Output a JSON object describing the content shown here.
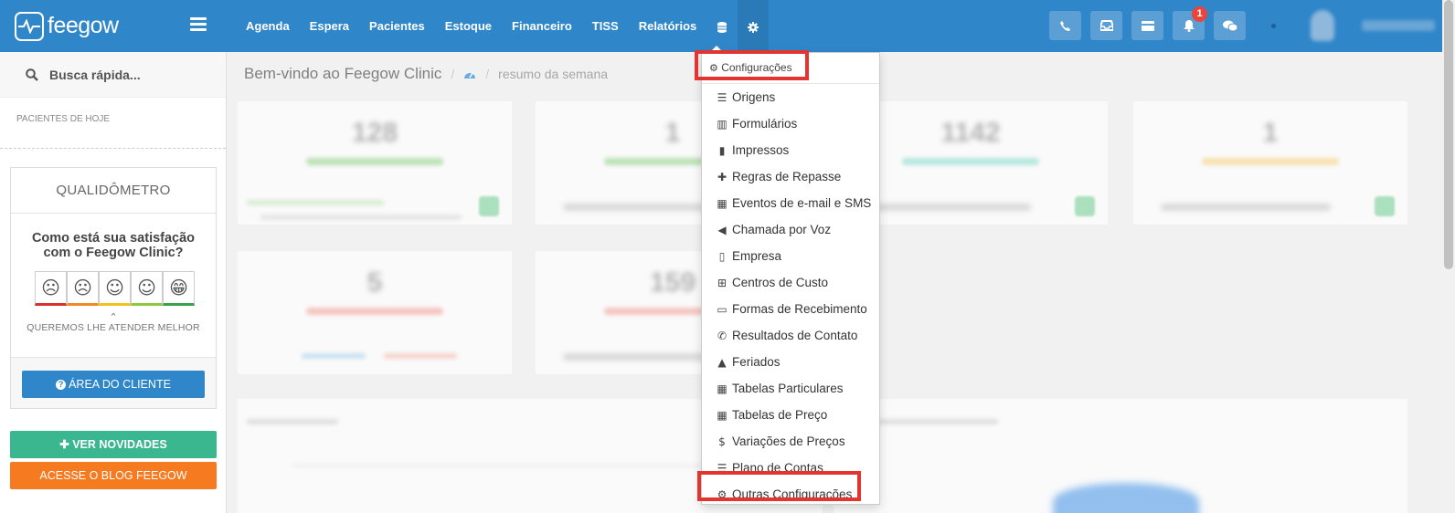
{
  "brand": {
    "name": "feegow"
  },
  "nav": {
    "items": [
      "Agenda",
      "Espera",
      "Pacientes",
      "Estoque",
      "Financeiro",
      "TISS",
      "Relatórios"
    ],
    "database_icon": "database-icon",
    "settings_icon": "gear-icon"
  },
  "topbar": {
    "notification_count": "1",
    "buttons": [
      "phone-icon",
      "inbox-icon",
      "card-icon",
      "bell-icon",
      "chat-icon"
    ]
  },
  "sidebar": {
    "search_placeholder": "Busca rápida...",
    "pacientes_hoje": "PACIENTES DE HOJE",
    "qualidometro_title": "QUALIDÔMETRO",
    "question": "Como está sua satisfação com o Feegow Clinic?",
    "faces": [
      "☹",
      "☹",
      "☺",
      "☺",
      "😁"
    ],
    "face_colors": [
      "#d9302b",
      "#f08a24",
      "#f2c418",
      "#8dc63f",
      "#3aa14d"
    ],
    "subtitle": "QUEREMOS LHE ATENDER MELHOR",
    "area_cliente": "ÁREA DO CLIENTE",
    "ver_novidades": "VER NOVIDADES",
    "blog": "ACESSE O BLOG FEEGOW"
  },
  "main": {
    "title": "Bem-vindo ao Feegow Clinic",
    "breadcrumb_sub": "resumo da semana"
  },
  "dropdown": {
    "header": "Configurações",
    "items": [
      {
        "icon": "☰",
        "label": "Origens"
      },
      {
        "icon": "▥",
        "label": "Formulários"
      },
      {
        "icon": "▮",
        "label": "Impressos"
      },
      {
        "icon": "✚",
        "label": "Regras de Repasse"
      },
      {
        "icon": "▦",
        "label": "Eventos de e-mail e SMS"
      },
      {
        "icon": "◀",
        "label": "Chamada por Voz"
      },
      {
        "icon": "▯",
        "label": "Empresa"
      },
      {
        "icon": "⊞",
        "label": "Centros de Custo"
      },
      {
        "icon": "▭",
        "label": "Formas de Recebimento"
      },
      {
        "icon": "✆",
        "label": "Resultados de Contato"
      },
      {
        "icon": "▲",
        "label": "Feriados"
      },
      {
        "icon": "▦",
        "label": "Tabelas Particulares"
      },
      {
        "icon": "▦",
        "label": "Tabelas de Preço"
      },
      {
        "icon": "$",
        "label": "Variações de Preços"
      },
      {
        "icon": "☰",
        "label": "Plano de Contas"
      },
      {
        "icon": "⚙",
        "label": "Outras Configurações"
      }
    ]
  },
  "colors": {
    "topbar": "#2f86c9",
    "highlight": "#e3342f",
    "green_button": "#3bb78f",
    "orange_button": "#f57a20"
  }
}
